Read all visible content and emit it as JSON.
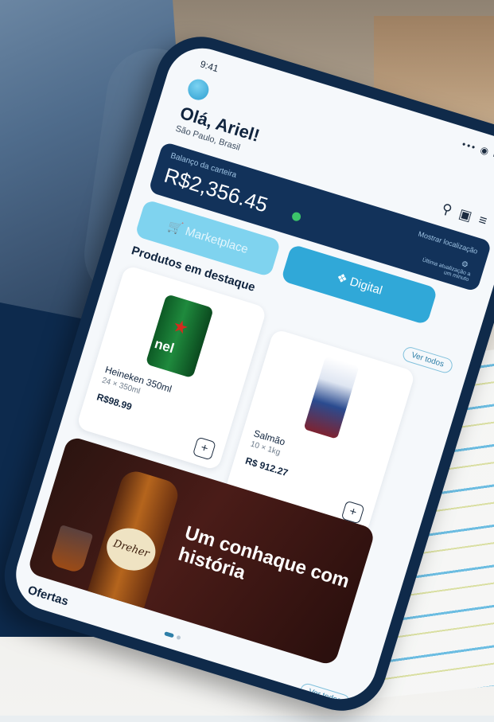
{
  "status": {
    "time": "9:41",
    "icons": "••• ◉ ▬"
  },
  "header": {
    "greeting": "Olá, Ariel!",
    "location": "São Paulo, Brasil",
    "icons": [
      "search-icon",
      "bag-icon",
      "menu-icon"
    ]
  },
  "wallet": {
    "label": "Balanço da carteira",
    "balance": "R$2,356.45",
    "link": "Mostrar localização",
    "update_note": "Última atualização a um minuto",
    "status_color": "#3cc46a"
  },
  "actions": {
    "marketplace": "Marketplace",
    "digital": "Digital"
  },
  "featured": {
    "title": "Produtos em destaque",
    "see_all": "Ver todos",
    "products": [
      {
        "name": "Heineken 350ml",
        "qty": "24 × 350ml",
        "price": "R$98.99",
        "add": "+",
        "image_text": "nel"
      },
      {
        "name": "Salmão",
        "qty": "10 × 1kg",
        "price": "R$ 912.27",
        "add": "+"
      }
    ]
  },
  "banner": {
    "text": "Um conhaque com história",
    "bottle_label": "Dreher"
  },
  "offers": {
    "title": "Ofertas",
    "see_all": "Ver todos"
  },
  "colors": {
    "navy": "#12325a",
    "accent": "#30a8d8",
    "light_accent": "#7fd3ef"
  }
}
